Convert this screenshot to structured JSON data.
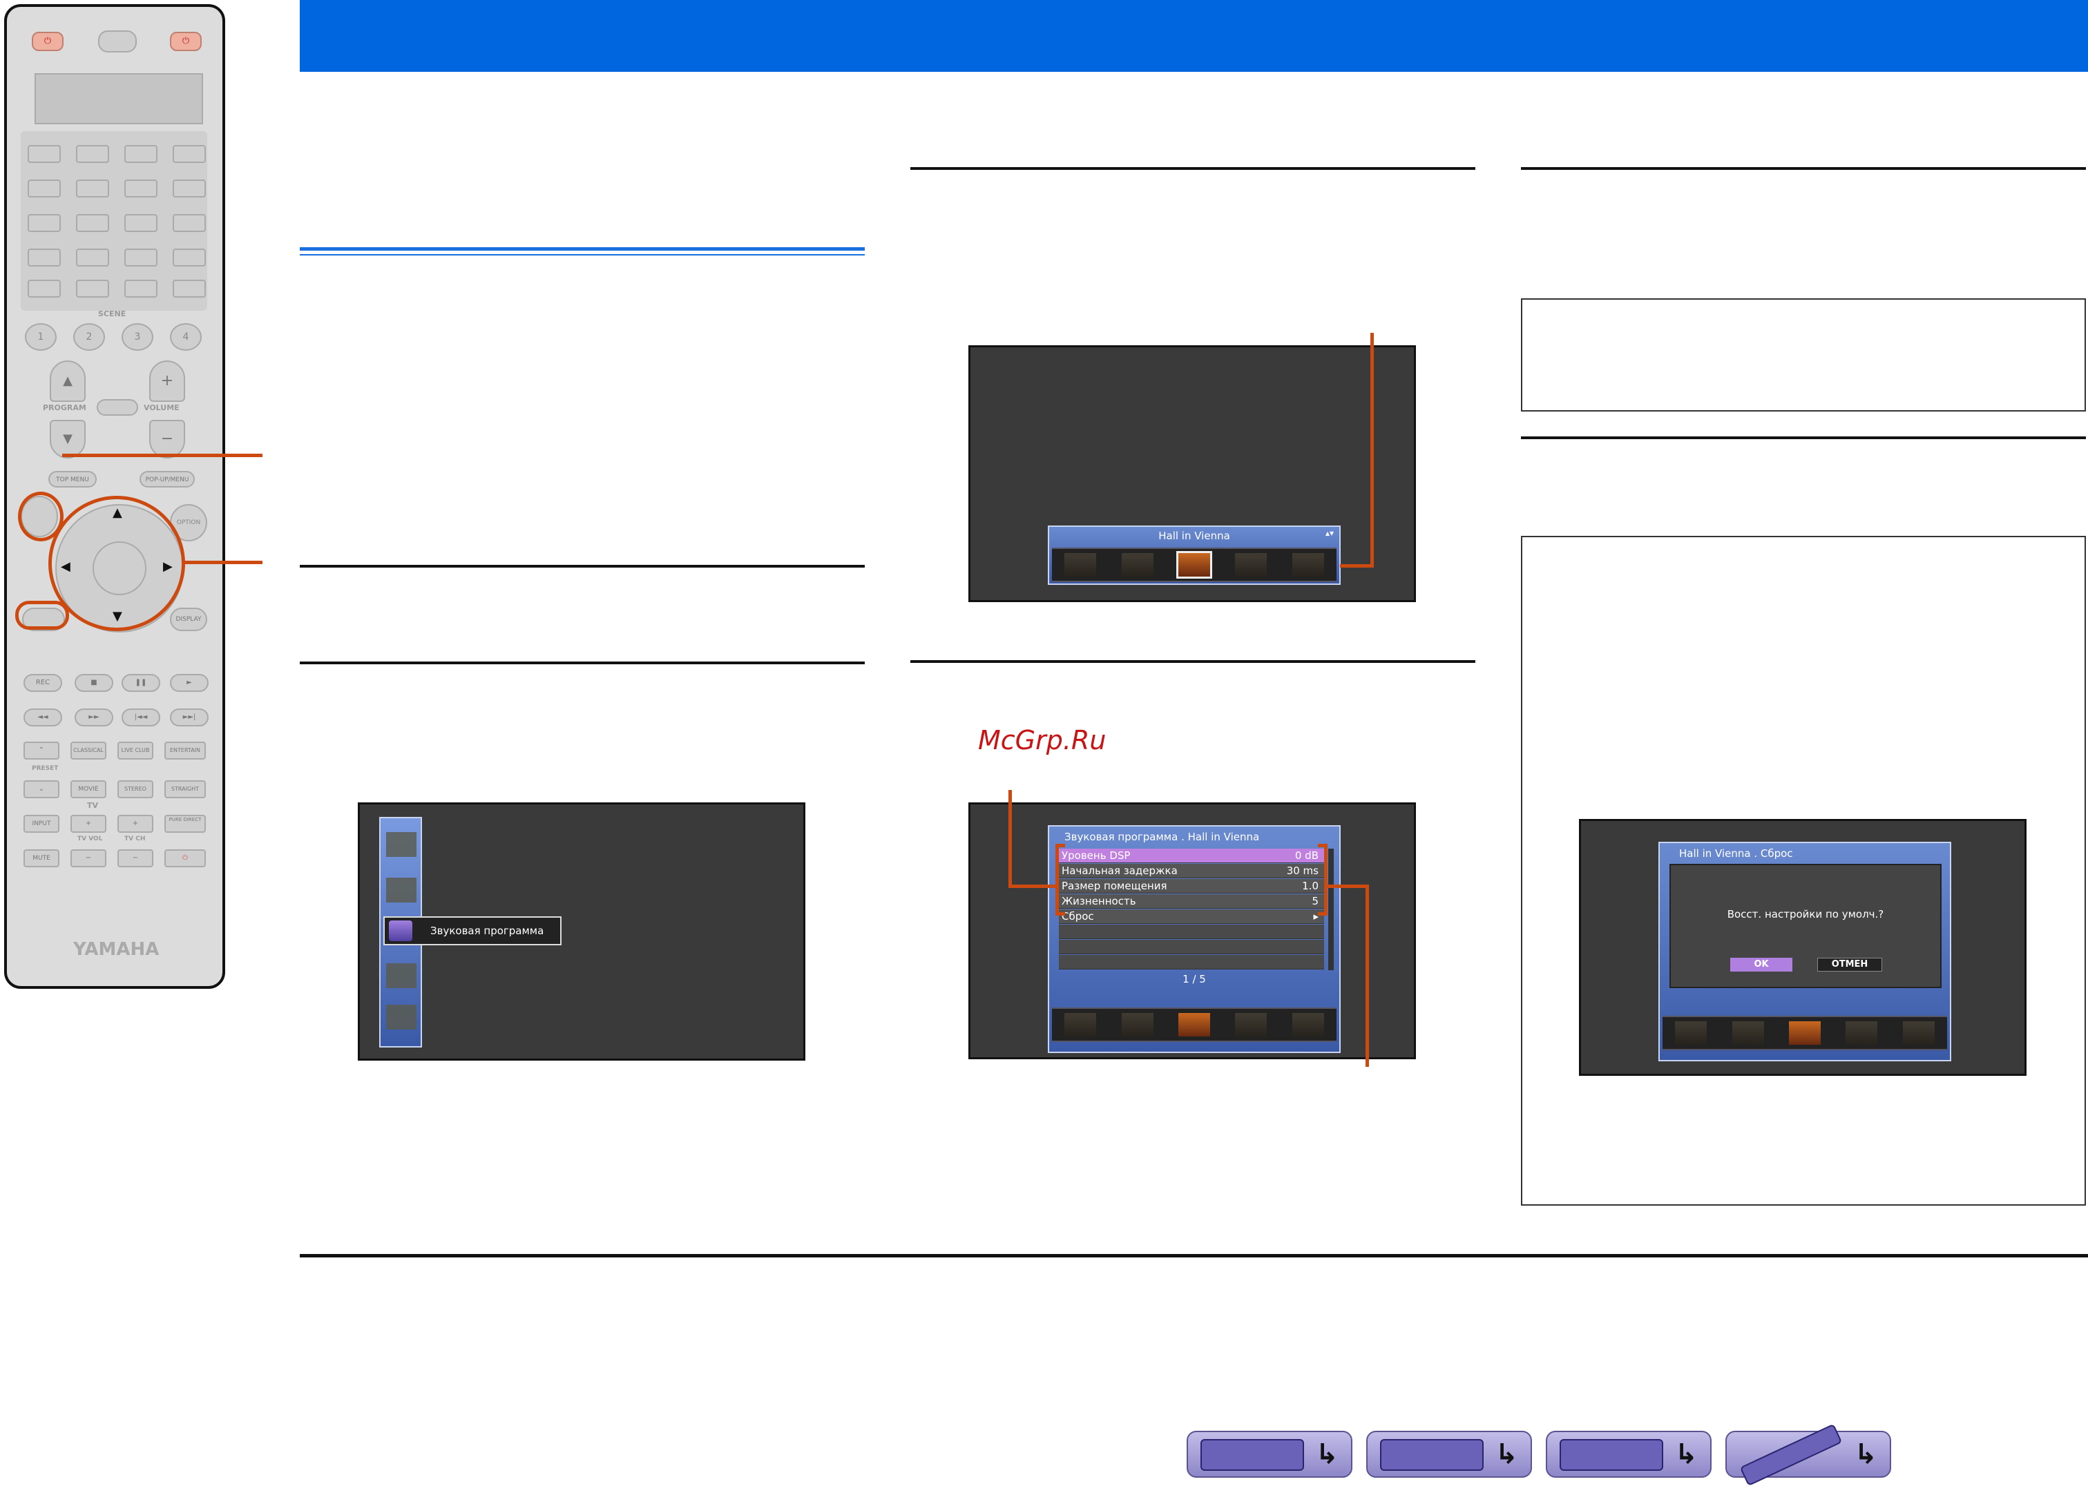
{
  "remote": {
    "scene_label": "SCENE",
    "scene_buttons": [
      "1",
      "2",
      "3",
      "4"
    ],
    "program_label": "PROGRAM",
    "volume_label": "VOLUME",
    "top_menu": "TOP MENU",
    "popup_menu": "POP-UP/MENU",
    "option": "OPTION",
    "display": "DISPLAY",
    "transport": [
      "REC",
      "■",
      "❚❚",
      "►"
    ],
    "sound_modes": [
      "CLASSICAL",
      "LIVE CLUB",
      "ENTERTAIN",
      "MOVIE",
      "STEREO",
      "STRAIGHT"
    ],
    "preset_label": "PRESET",
    "tv_label": "TV",
    "input": "INPUT",
    "tv_vol": "TV VOL",
    "tv_ch": "TV CH",
    "pure_direct": "PURE DIRECT",
    "mute": "MUTE",
    "brand": "YAMAHA"
  },
  "screen1": {
    "menu_item_label": "Звуковая программа"
  },
  "screen2": {
    "program_name": "Hall in Vienna"
  },
  "watermark": "McGrp.Ru",
  "screen3": {
    "title": "Звуковая программа . Hall in Vienna",
    "rows": [
      {
        "label": "Уровень DSP",
        "value": "0 dB"
      },
      {
        "label": "Начальная задержка",
        "value": "30 ms"
      },
      {
        "label": "Размер помещения",
        "value": "1.0"
      },
      {
        "label": "Жизненность",
        "value": "5"
      },
      {
        "label": "Сброс",
        "value": "▸"
      }
    ],
    "page": "1 / 5"
  },
  "screen4": {
    "title": "Hall in Vienna . Сброс",
    "message": "Восст. настройки по умолч.?",
    "ok": "OK",
    "cancel": "ОТМЕН"
  },
  "colors": {
    "header_blue": "#0066e0",
    "callout_orange": "#cc4a10",
    "watermark_red": "#c81414"
  }
}
